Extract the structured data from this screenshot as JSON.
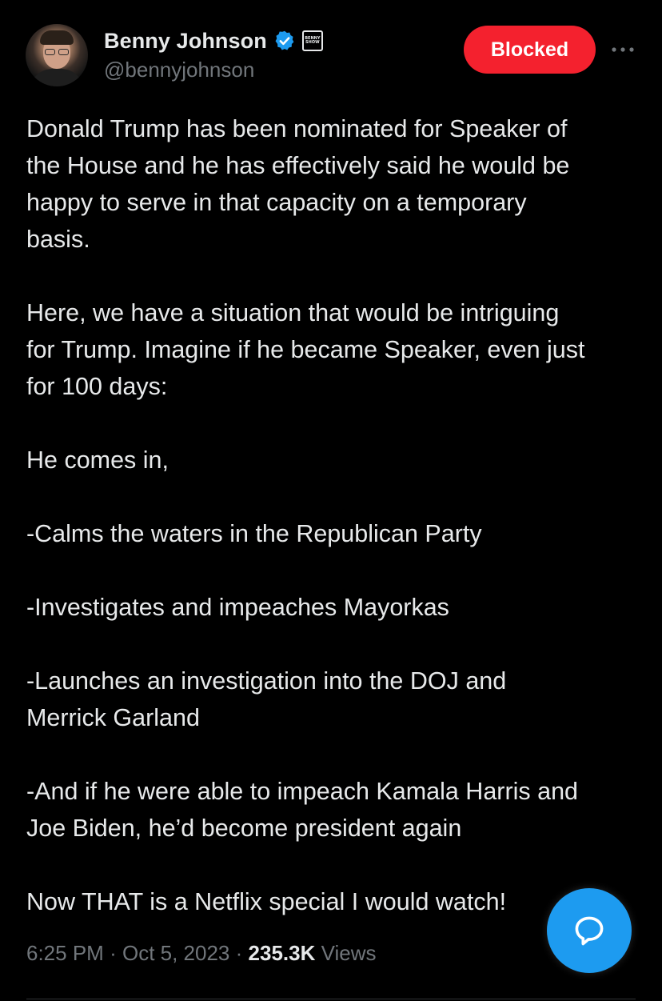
{
  "header": {
    "display_name": "Benny Johnson",
    "handle": "@bennyjohnson",
    "affiliate_badge_text": "BENNY SHOW",
    "blocked_label": "Blocked",
    "avatar_icon": "profile-photo-icon",
    "verified_icon": "verified-badge-icon",
    "more_icon": "more-dots-icon"
  },
  "tweet": {
    "paragraphs": [
      "Donald Trump has been nominated for Speaker of\nthe House and he has effectively said he would be\nhappy to serve in that capacity on a temporary\nbasis.",
      "Here, we have a situation that would be intriguing\nfor Trump. Imagine if he became Speaker, even just\nfor 100 days:",
      "He comes in,",
      "-Calms the waters in the Republican Party",
      "-Investigates and impeaches Mayorkas",
      "-Launches an investigation into the DOJ and\nMerrick Garland",
      "-And if he were able to impeach Kamala Harris and\nJoe Biden, he’d become president again",
      "Now THAT is a Netflix special I would watch!"
    ]
  },
  "meta": {
    "time": "6:25 PM",
    "separator": "·",
    "date": "Oct 5, 2023",
    "views_count": "235.3K",
    "views_label": "Views"
  },
  "fab": {
    "icon": "compose-reply-icon"
  },
  "colors": {
    "background": "#000000",
    "text": "#e7e9ea",
    "muted": "#71767b",
    "blocked_red": "#f4212e",
    "accent_blue": "#1d9bf0"
  }
}
